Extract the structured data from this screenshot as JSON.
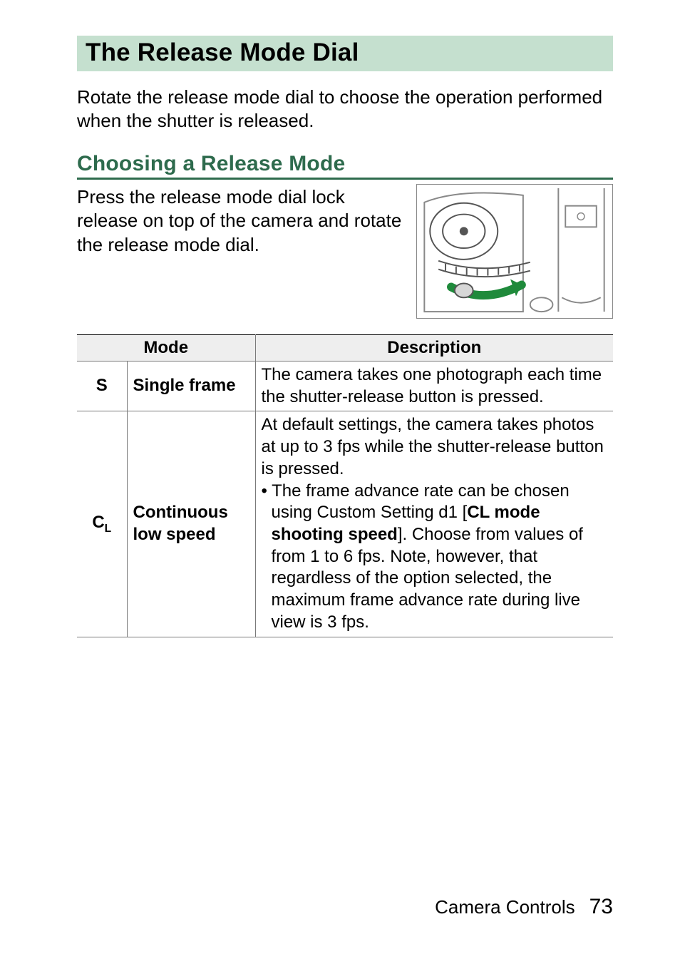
{
  "heading": "The Release Mode Dial",
  "intro": "Rotate the release mode dial to choose the operation performed when the shutter is released.",
  "subheading": "Choosing a Release Mode",
  "subtext": "Press the release mode dial lock release on top of the camera and rotate the release mode dial.",
  "table": {
    "headers": {
      "mode": "Mode",
      "description": "Description"
    },
    "rows": [
      {
        "symbol": "S",
        "symbol_sub": "",
        "label": "Single frame",
        "desc_plain": "The camera takes one photograph each time the shutter-release button is pressed."
      },
      {
        "symbol": "C",
        "symbol_sub": "L",
        "label": "Continuous low speed",
        "desc_plain": "At default settings, the camera takes photos at up to 3 fps while the shutter-release button is pressed.",
        "bullet_pre": "The frame advance rate can be chosen using Custom Setting d1 [",
        "bullet_bold": "CL mode shooting speed",
        "bullet_post": "]. Choose from values of from 1 to 6 fps. Note, however, that regardless of the option selected, the maximum frame advance rate during live view is 3 fps."
      }
    ]
  },
  "footer": {
    "section": "Camera Controls",
    "page": "73"
  }
}
